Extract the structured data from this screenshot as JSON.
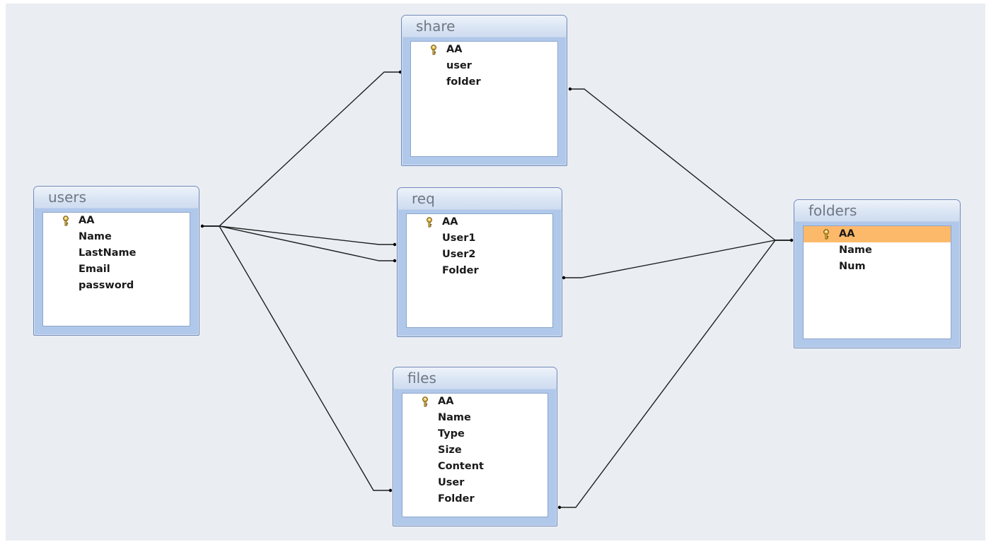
{
  "tables": {
    "users": {
      "title": "users",
      "fields": [
        "AA",
        "Name",
        "LastName",
        "Email",
        "password"
      ]
    },
    "share": {
      "title": "share",
      "fields": [
        "AA",
        "user",
        "folder"
      ]
    },
    "req": {
      "title": "req",
      "fields": [
        "AA",
        "User1",
        "User2",
        "Folder"
      ]
    },
    "files": {
      "title": "files",
      "fields": [
        "AA",
        "Name",
        "Type",
        "Size",
        "Content",
        "User",
        "Folder"
      ]
    },
    "folders": {
      "title": "folders",
      "fields": [
        "AA",
        "Name",
        "Num"
      ],
      "selected_field": "AA"
    }
  },
  "icons": {
    "primary_key": "key-icon"
  },
  "colors": {
    "pane_background": "#eaeef3",
    "table_frame": "#b0c8ea",
    "selected_row": "#fdb96a",
    "relationship_line": "#1f1f1f"
  }
}
